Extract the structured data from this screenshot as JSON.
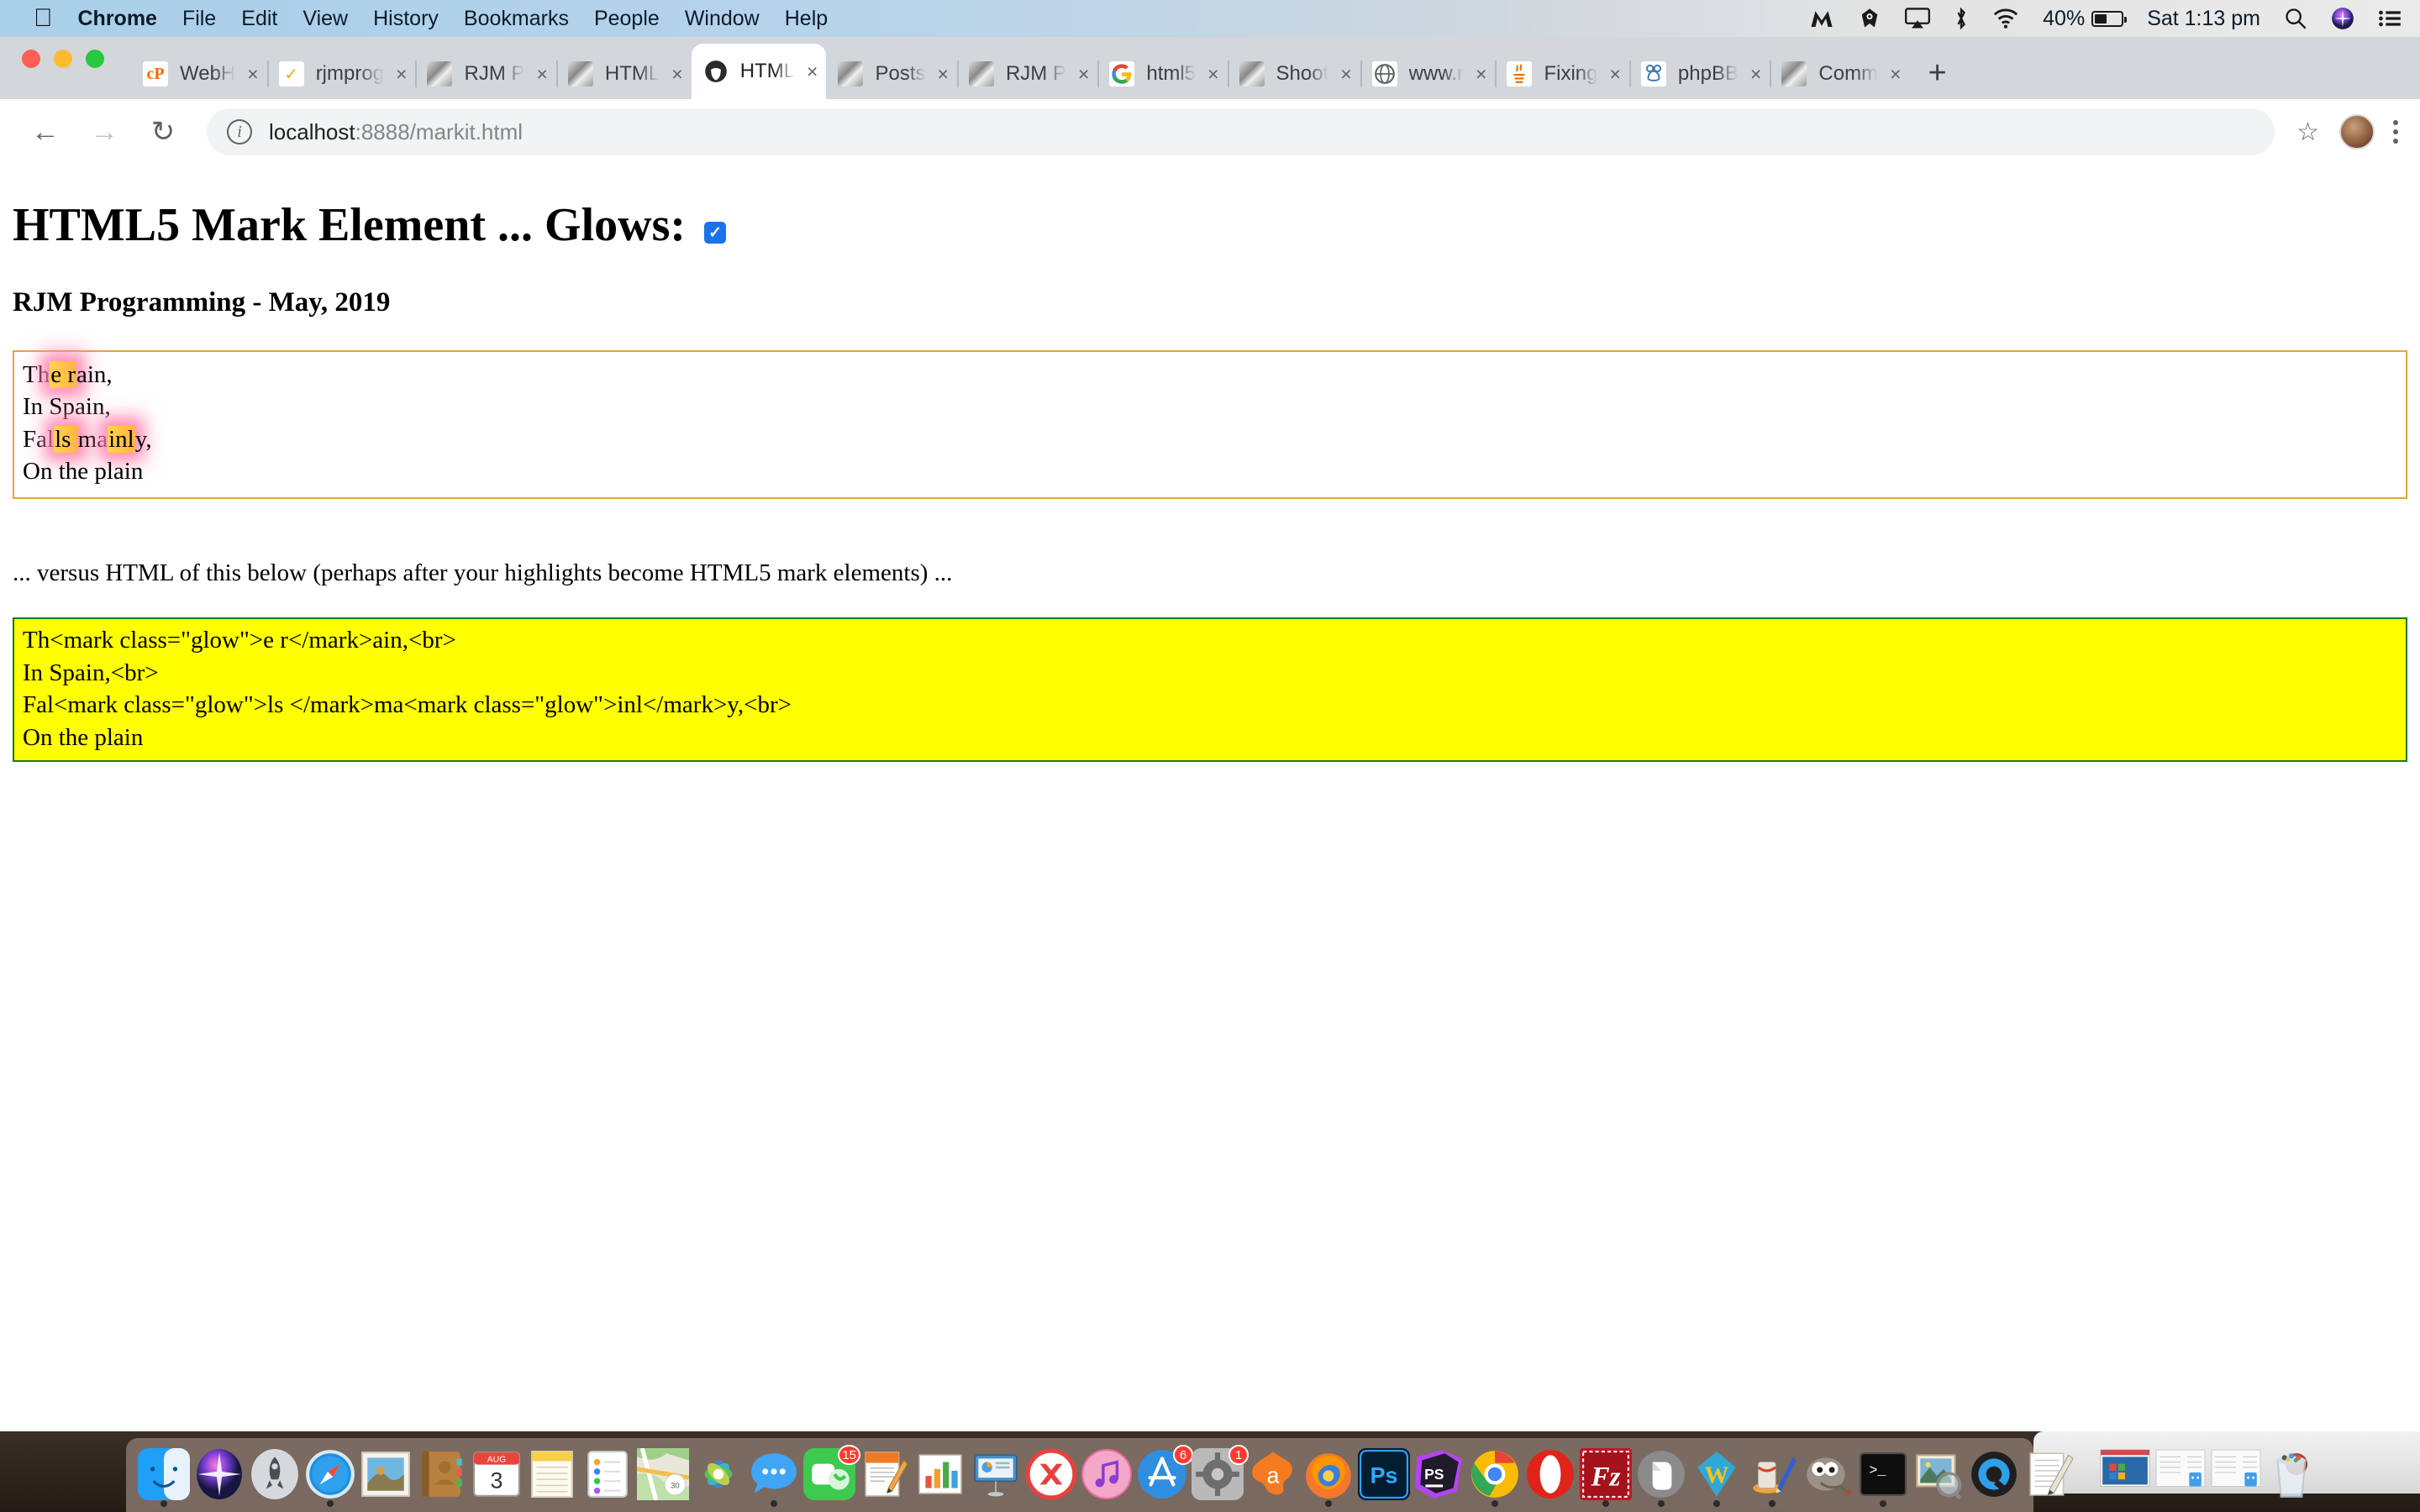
{
  "menubar": {
    "apple_icon": "apple-icon",
    "items": [
      {
        "label": "Chrome",
        "bold": true
      },
      {
        "label": "File",
        "bold": false
      },
      {
        "label": "Edit",
        "bold": false
      },
      {
        "label": "View",
        "bold": false
      },
      {
        "label": "History",
        "bold": false
      },
      {
        "label": "Bookmarks",
        "bold": false
      },
      {
        "label": "People",
        "bold": false
      },
      {
        "label": "Window",
        "bold": false
      },
      {
        "label": "Help",
        "bold": false
      }
    ],
    "status": {
      "malwarebytes_icon": "malwarebytes-icon",
      "avast_icon": "avast-icon",
      "airplay_icon": "airplay-icon",
      "bluetooth_icon": "bluetooth-icon",
      "wifi_icon": "wifi-icon",
      "battery_percent": "40%",
      "clock": "Sat 1:13 pm",
      "spotlight_icon": "search-icon",
      "siri_icon": "siri-icon",
      "notification_icon": "notification-center-icon"
    }
  },
  "browser": {
    "window_controls": [
      "close",
      "minimize",
      "zoom"
    ],
    "tabs": [
      {
        "label": "WebH",
        "favicon": "cpanel-icon",
        "active": false,
        "close_label": "×"
      },
      {
        "label": "rjmprog",
        "favicon": "check-icon",
        "active": false,
        "close_label": "×"
      },
      {
        "label": "RJM P",
        "favicon": "rjm-icon",
        "active": false,
        "close_label": "×"
      },
      {
        "label": "HTML",
        "favicon": "rjm-icon",
        "active": false,
        "close_label": "×"
      },
      {
        "label": "HTML",
        "favicon": "html-koala-icon",
        "active": true,
        "close_label": "×"
      },
      {
        "label": "Posts",
        "favicon": "rjm-icon",
        "active": false,
        "close_label": "×"
      },
      {
        "label": "RJM P",
        "favicon": "rjm-icon",
        "active": false,
        "close_label": "×"
      },
      {
        "label": "html5",
        "favicon": "google-icon",
        "active": false,
        "close_label": "×"
      },
      {
        "label": "Shoot",
        "favicon": "rjm-icon",
        "active": false,
        "close_label": "×"
      },
      {
        "label": "www.r",
        "favicon": "globe-icon",
        "active": false,
        "close_label": "×"
      },
      {
        "label": "Fixing",
        "favicon": "java-icon",
        "active": false,
        "close_label": "×"
      },
      {
        "label": "phpBB",
        "favicon": "phpbb-icon",
        "active": false,
        "close_label": "×"
      },
      {
        "label": "Comm",
        "favicon": "rjm-icon",
        "active": false,
        "close_label": "×"
      }
    ],
    "new_tab_label": "+",
    "toolbar": {
      "back_label": "←",
      "forward_label": "→",
      "reload_label": "↻",
      "site_info_label": "i",
      "url_host": "localhost",
      "url_rest": ":8888/markit.html",
      "url_full": "localhost:8888/markit.html",
      "bookmark_label": "☆",
      "menu_label": "kebab-menu"
    }
  },
  "page": {
    "title": "HTML5 Mark Element ... Glows:",
    "glow_checkbox_checked": true,
    "glow_checkbox_glyph": "✓",
    "subtitle": "RJM Programming - May, 2019",
    "editable_lines": [
      {
        "segments": [
          {
            "text": "Th",
            "glow": false
          },
          {
            "text": "e r",
            "glow": true
          },
          {
            "text": "ain,",
            "glow": false
          }
        ]
      },
      {
        "segments": [
          {
            "text": "In Spain,",
            "glow": false
          }
        ]
      },
      {
        "segments": [
          {
            "text": "Fal",
            "glow": false
          },
          {
            "text": "ls ",
            "glow": true
          },
          {
            "text": "ma",
            "glow": false
          },
          {
            "text": "inl",
            "glow": true
          },
          {
            "text": "y,",
            "glow": false
          }
        ]
      },
      {
        "segments": [
          {
            "text": "On the plain",
            "glow": false
          }
        ]
      }
    ],
    "versus_text": "... versus HTML of this below (perhaps after your highlights become HTML5 mark elements) ...",
    "code_lines": [
      "Th<mark class=\"glow\">e r</mark>ain,<br>",
      "In Spain,<br>",
      "Fal<mark class=\"glow\">ls </mark>ma<mark class=\"glow\">inl</mark>y,<br>",
      "On the plain"
    ],
    "colors": {
      "edit_border": "#e8a33d",
      "code_background": "#ffff00",
      "code_border": "#1a7a1a",
      "glow_pink": "#ff78aa",
      "glow_yellow": "#ffd54a",
      "checkbox_blue": "#1a73e8"
    }
  },
  "dock": {
    "apps": [
      {
        "name": "finder-icon",
        "running": true
      },
      {
        "name": "siri-icon",
        "running": false
      },
      {
        "name": "launchpad-icon",
        "running": false
      },
      {
        "name": "safari-icon",
        "running": true
      },
      {
        "name": "mail-icon",
        "running": false
      },
      {
        "name": "contacts-icon",
        "running": false
      },
      {
        "name": "calendar-icon",
        "running": false,
        "label_month": "AUG",
        "label_day": "3"
      },
      {
        "name": "notes-icon",
        "running": false
      },
      {
        "name": "reminders-icon",
        "running": false
      },
      {
        "name": "maps-icon",
        "running": false
      },
      {
        "name": "photos-icon",
        "running": false
      },
      {
        "name": "messages-icon",
        "running": true
      },
      {
        "name": "facetime-icon",
        "running": false,
        "badge": "15"
      },
      {
        "name": "pages-icon",
        "running": false
      },
      {
        "name": "numbers-icon",
        "running": false
      },
      {
        "name": "keynote-icon",
        "running": false
      },
      {
        "name": "news-icon",
        "running": false
      },
      {
        "name": "itunes-icon",
        "running": false
      },
      {
        "name": "app-store-icon",
        "running": false,
        "badge": "6"
      },
      {
        "name": "system-preferences-icon",
        "running": false,
        "badge": "1"
      },
      {
        "name": "avast-icon",
        "running": false
      },
      {
        "name": "firefox-icon",
        "running": true
      },
      {
        "name": "photoshop-icon",
        "running": false
      },
      {
        "name": "phpstorm-icon",
        "running": false
      },
      {
        "name": "chrome-icon",
        "running": true
      },
      {
        "name": "opera-icon",
        "running": false
      },
      {
        "name": "filezilla-icon",
        "running": true
      },
      {
        "name": "evernote-icon",
        "running": true
      },
      {
        "name": "wordpress-icon",
        "running": true
      },
      {
        "name": "paint-icon",
        "running": true
      },
      {
        "name": "gimp-icon",
        "running": false
      },
      {
        "name": "terminal-icon",
        "running": true
      },
      {
        "name": "preview-icon",
        "running": false
      },
      {
        "name": "quicktime-icon",
        "running": false
      },
      {
        "name": "textedit-icon",
        "running": false
      }
    ],
    "minimized": [
      {
        "name": "minimized-window-parallels"
      },
      {
        "name": "minimized-window-finder-1"
      },
      {
        "name": "minimized-window-finder-2"
      }
    ],
    "trash": {
      "name": "trash-icon"
    }
  }
}
